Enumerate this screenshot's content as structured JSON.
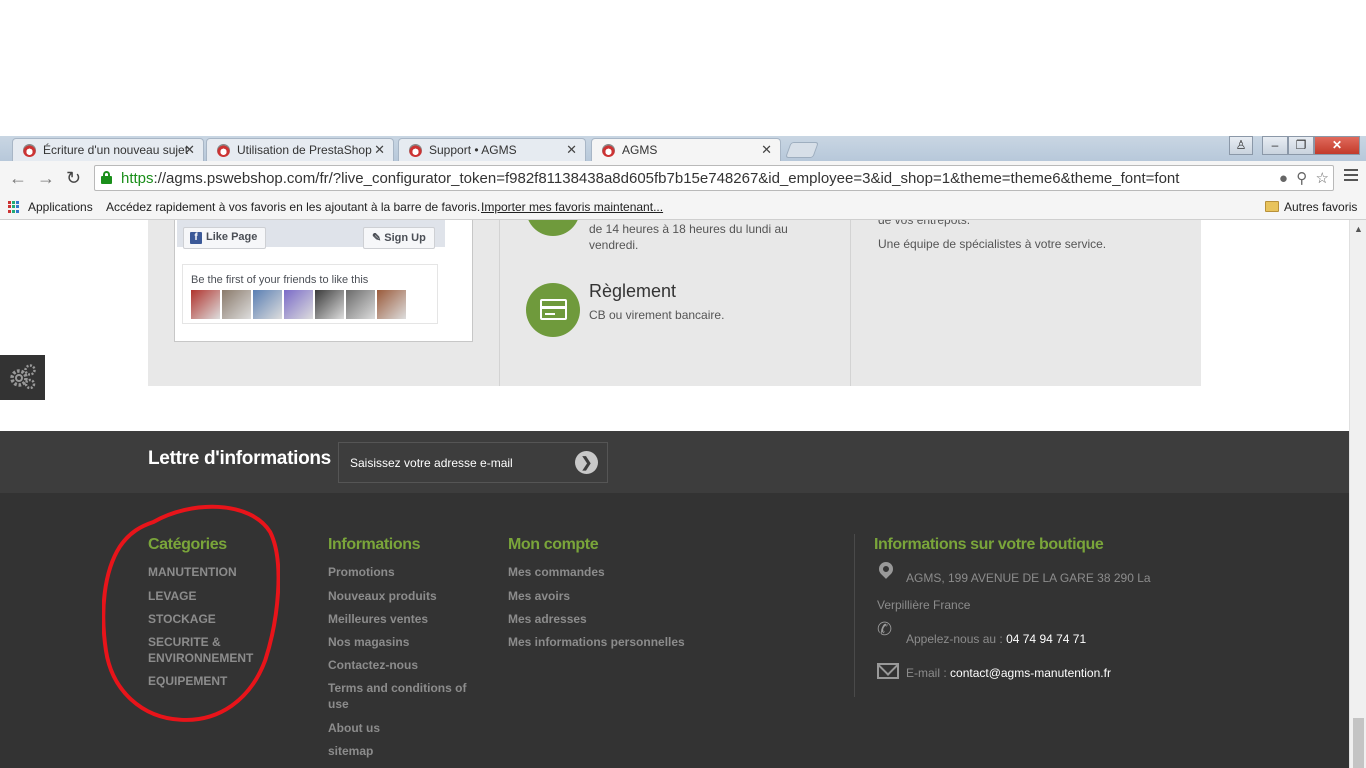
{
  "browser": {
    "tabs": [
      {
        "title": "Écriture d'un nouveau sujet"
      },
      {
        "title": "Utilisation de PrestaShop"
      },
      {
        "title": "Support • AGMS"
      },
      {
        "title": "AGMS"
      }
    ],
    "url_scheme": "https",
    "url_rest": "://agms.pswebshop.com/fr/?live_configurator_token=f982f81138438a8d605fb7b15e748267&id_employee=3&id_shop=1&theme=theme6&theme_font=font",
    "bookmarks": {
      "apps": "Applications",
      "hint": "Accédez rapidement à vos favoris en les ajoutant à la barre de favoris.",
      "import_link": "Importer mes favoris maintenant...",
      "other": "Autres favoris"
    }
  },
  "facebook": {
    "like_label": "Like Page",
    "signup_label": "Sign Up",
    "friends_text": "Be the first of your friends to like this",
    "avatar_colors": [
      "#b0332d",
      "#8a7a6a",
      "#5a7fb3",
      "#7a6ac8",
      "#3a3a3a",
      "#6a6a6a",
      "#9a5a3a"
    ]
  },
  "features": {
    "hours_line1": "de 14 heures à 18 heures du lundi au",
    "hours_line2": "vendredi.",
    "payment_title": "Règlement",
    "payment_text": "CB ou virement bancaire.",
    "service_partial": "de vos entrepots.",
    "service_text": "Une équipe de spécialistes à votre service."
  },
  "newsletter": {
    "title": "Lettre d'informations",
    "placeholder": "Saisissez votre adresse e-mail"
  },
  "footer": {
    "categories": {
      "title": "Catégories",
      "items": [
        "MANUTENTION",
        "LEVAGE",
        "STOCKAGE",
        "SECURITE &",
        "ENVIRONNEMENT",
        "EQUIPEMENT"
      ]
    },
    "informations": {
      "title": "Informations",
      "items": [
        "Promotions",
        "Nouveaux produits",
        "Meilleures ventes",
        "Nos magasins",
        "Contactez-nous",
        "Terms and conditions of",
        "use",
        "About us",
        "sitemap"
      ]
    },
    "account": {
      "title": "Mon compte",
      "items": [
        "Mes commandes",
        "Mes avoirs",
        "Mes adresses",
        "Mes informations personnelles"
      ]
    },
    "store": {
      "title": "Informations sur votre boutique",
      "address_line1": "AGMS, 199 AVENUE DE LA GARE 38 290 La",
      "address_line2": "Verpillière France",
      "phone_label": "Appelez-nous au : ",
      "phone": "04 74 94 74 71",
      "email_label": "E-mail : ",
      "email": "contact@agms-manutention.fr"
    }
  },
  "colors": {
    "accent_green": "#7aa53a",
    "circle_green": "#6f9a3c",
    "annotation_red": "#e8141a"
  }
}
